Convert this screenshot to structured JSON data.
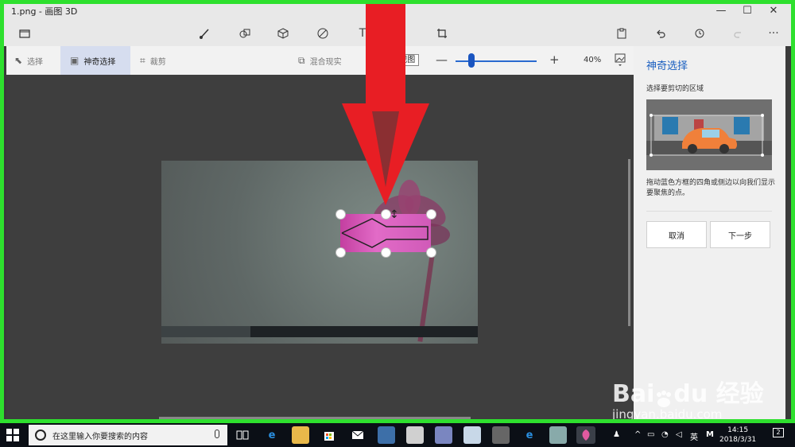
{
  "window": {
    "title": "1.png - 画图 3D",
    "minimize": "—",
    "maximize": "☐",
    "close": "✕"
  },
  "toolbar": {
    "more": "···",
    "text_tool": "T"
  },
  "subtoolbar": {
    "select_label": "选择",
    "magic_select_label": "神奇选择",
    "crop_label": "裁剪",
    "mixed_reality_label": "混合现实",
    "view3d_label": "3D 视图",
    "zoom_minus": "—",
    "zoom_plus": "+",
    "zoom_percent": "40%",
    "zoom_level": 0.16
  },
  "panel": {
    "title": "神奇选择",
    "subtitle": "选择要剪切的区域",
    "description": "拖动蓝色方框的四角或侧边以向我们显示要聚焦的点。",
    "cancel_label": "取消",
    "next_label": "下一步"
  },
  "watermark": {
    "logo": "Bai du 经验",
    "url": "jingyan.baidu.com"
  },
  "taskbar": {
    "search_placeholder": "在这里输入你要搜索的内容",
    "ime_label": "英",
    "time": "14:15",
    "date": "2018/3/31",
    "notification_count": "2",
    "m_label": "M"
  },
  "colors": {
    "frame": "#2ee02e",
    "accent": "#1a5fc0",
    "arrow": "#e81e24"
  }
}
